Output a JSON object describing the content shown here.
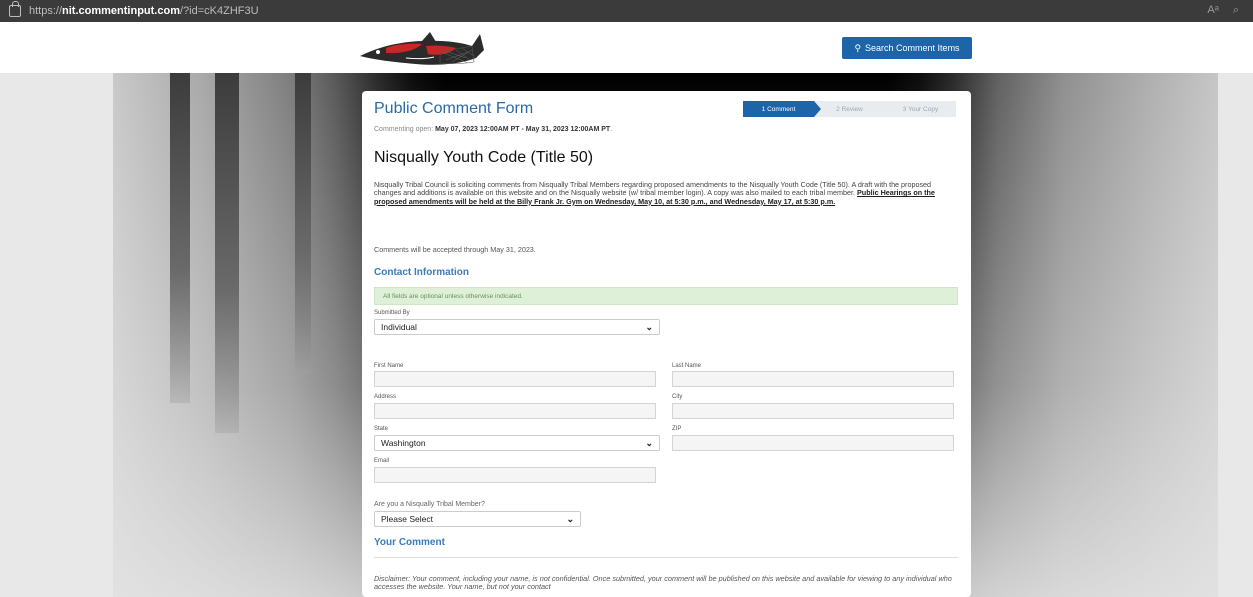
{
  "browser": {
    "url_prefix": "https://",
    "url_domain": "nit.commentinput.com",
    "url_path": "/?id=cK4ZHF3U",
    "read_aloud": "Aᵃ",
    "zoom_glyph": "⌕"
  },
  "header": {
    "search_label": "Search Comment Items"
  },
  "form": {
    "title": "Public Comment Form",
    "steps": [
      "1 Comment",
      "2 Review",
      "3 Your Copy"
    ],
    "active_step": 1,
    "commenting_prefix": "Commenting open: ",
    "commenting_dates": "May 07, 2023 12:00AM PT - May 31, 2023 12:00AM PT",
    "commenting_suffix": ".",
    "doc_title": "Nisqually Youth Code (Title 50)",
    "desc_plain": "Nisqually Tribal Council is soliciting comments from Nisqually Tribal Members regarding proposed amendments to the Nisqually Youth Code (Title 50). A draft with the proposed changes and additions is available on this website and on the Nisqually website (w/ tribal member login). A copy was also mailed to each tribal member. ",
    "desc_highlight": "Public Hearings on the proposed amendments will be held at the Billy Frank Jr. Gym on Wednesday, May 10, at 5:30 p.m., and Wednesday, May 17, at 5:30 p.m.",
    "accepted": "Comments will be accepted through May 31, 2023.",
    "contact_heading": "Contact Information",
    "optional_notice": "All fields are optional unless otherwise indicated.",
    "submitted_by_label": "Submitted By",
    "submitted_by_value": "Individual",
    "first_name_label": "First Name",
    "last_name_label": "Last Name",
    "address_label": "Address",
    "city_label": "City",
    "state_label": "State",
    "state_value": "Washington",
    "zip_label": "ZIP",
    "email_label": "Email",
    "member_question": "Are you a Nisqually Tribal Member?",
    "member_value": "Please Select",
    "comment_heading": "Your Comment",
    "disclaimer": "Disclaimer: Your comment, including your name, is not confidential. Once submitted, your comment will be published on this website and available for viewing to any individual who accesses the website. Your name, but not your contact"
  }
}
